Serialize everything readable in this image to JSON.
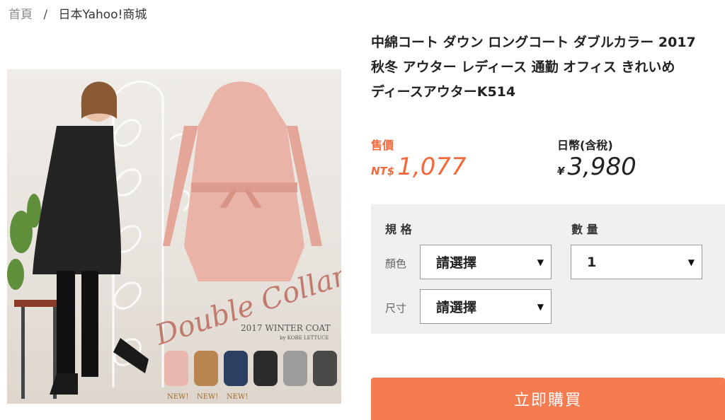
{
  "breadcrumb": {
    "home": "首頁",
    "separator": "/",
    "current": "日本Yahoo!商城"
  },
  "product": {
    "title_lines": [
      "中綿コート ダウン ロングコート ダブルカラー 2017",
      "秋冬 アウター レディース 通勤 オフィス きれいめ",
      "ディースアウターK514"
    ],
    "image": {
      "brand_script": "Double Collar",
      "caption": "2017 WINTER COAT",
      "brand": "by KOBE LETTUCE",
      "swatch_badges": [
        "NEW!",
        "NEW!",
        "NEW!"
      ],
      "swatch_colors": [
        "#e9b7ad",
        "#b8864e",
        "#2a3f62",
        "#2b2b2b",
        "#9c9c9c",
        "#4a4a48"
      ]
    }
  },
  "pricing": {
    "sale_label": "售價",
    "sale_currency": "NT$",
    "sale_amount": "1,077",
    "yen_label": "日幣(含稅)",
    "yen_currency": "¥",
    "yen_amount": "3,980"
  },
  "options": {
    "spec_heading": "規 格",
    "qty_heading": "數 量",
    "color_label": "顏色",
    "size_label": "尺寸",
    "color_value": "請選擇",
    "size_value": "請選擇",
    "qty_value": "1"
  },
  "actions": {
    "buy_label": "立即購買"
  },
  "colors": {
    "accent": "#f26a3c",
    "button": "#f57b51"
  }
}
